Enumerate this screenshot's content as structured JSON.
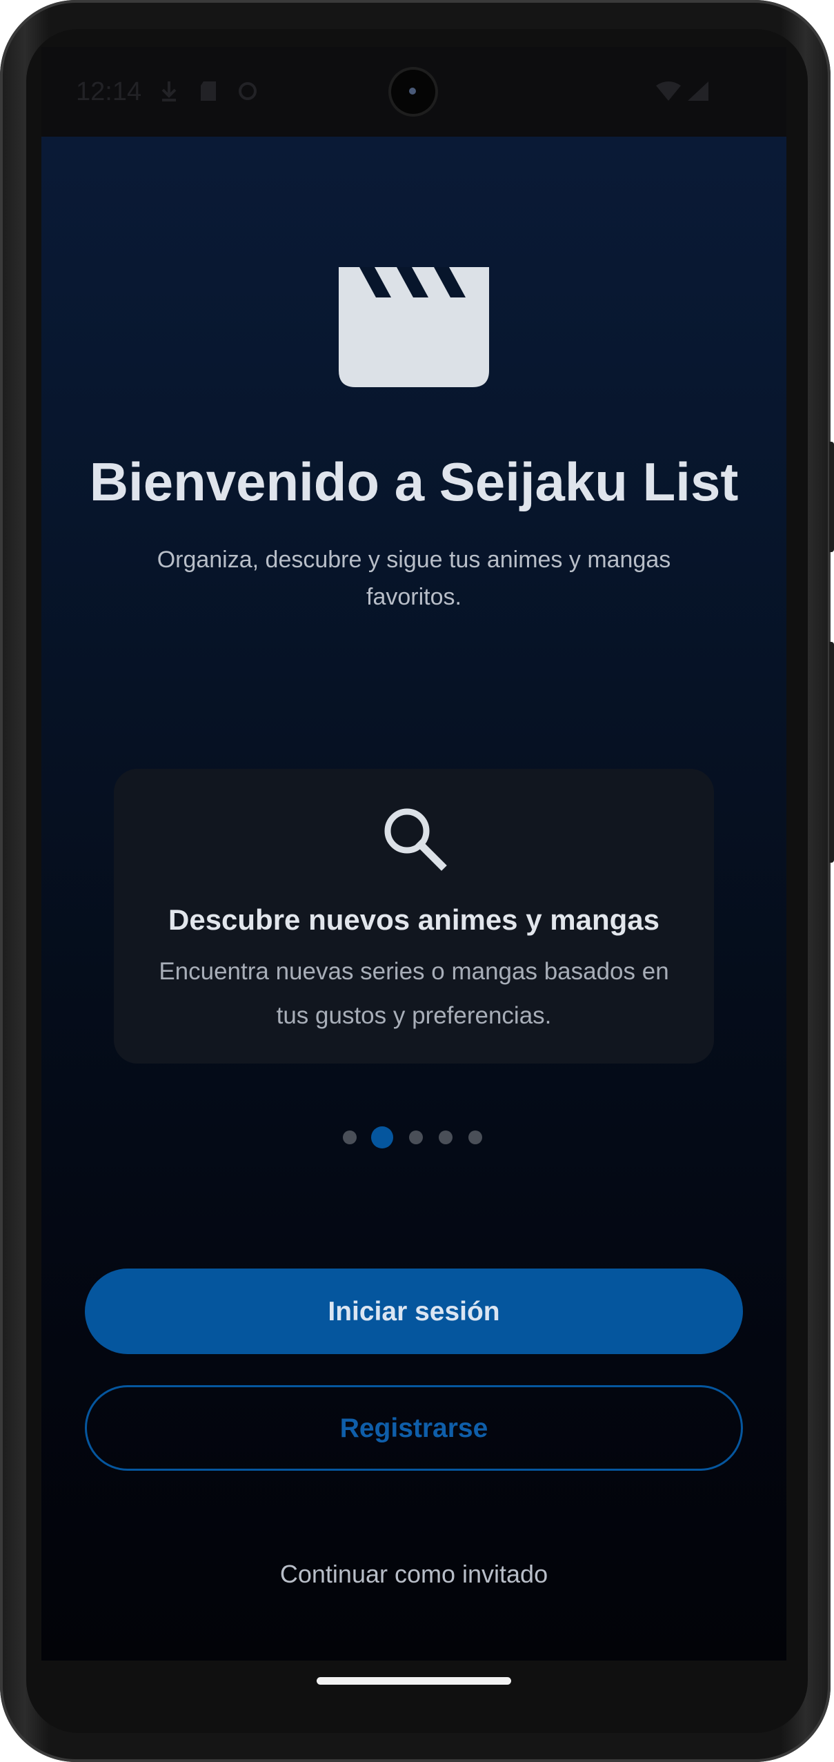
{
  "status_bar": {
    "time": "12:14",
    "icons": [
      "download-icon",
      "sd-card-icon",
      "sync-icon",
      "wifi-icon",
      "signal-icon"
    ]
  },
  "welcome": {
    "logo_icon": "clapperboard-icon",
    "title": "Bienvenido a Seijaku List",
    "subtitle": "Organiza, descubre y sigue tus animes y mangas favoritos."
  },
  "carousel": {
    "icon": "search-icon",
    "title": "Descubre nuevos animes y mangas",
    "description": "Encuentra nuevas series o mangas basados en tus gustos y preferencias.",
    "page_count": 5,
    "active_index": 1
  },
  "actions": {
    "login_label": "Iniciar sesión",
    "register_label": "Registrarse",
    "guest_label": "Continuar como invitado"
  },
  "colors": {
    "accent": "#05569e",
    "background_top": "#0a1a36",
    "background_bottom": "#020308",
    "card": "#11161f"
  }
}
